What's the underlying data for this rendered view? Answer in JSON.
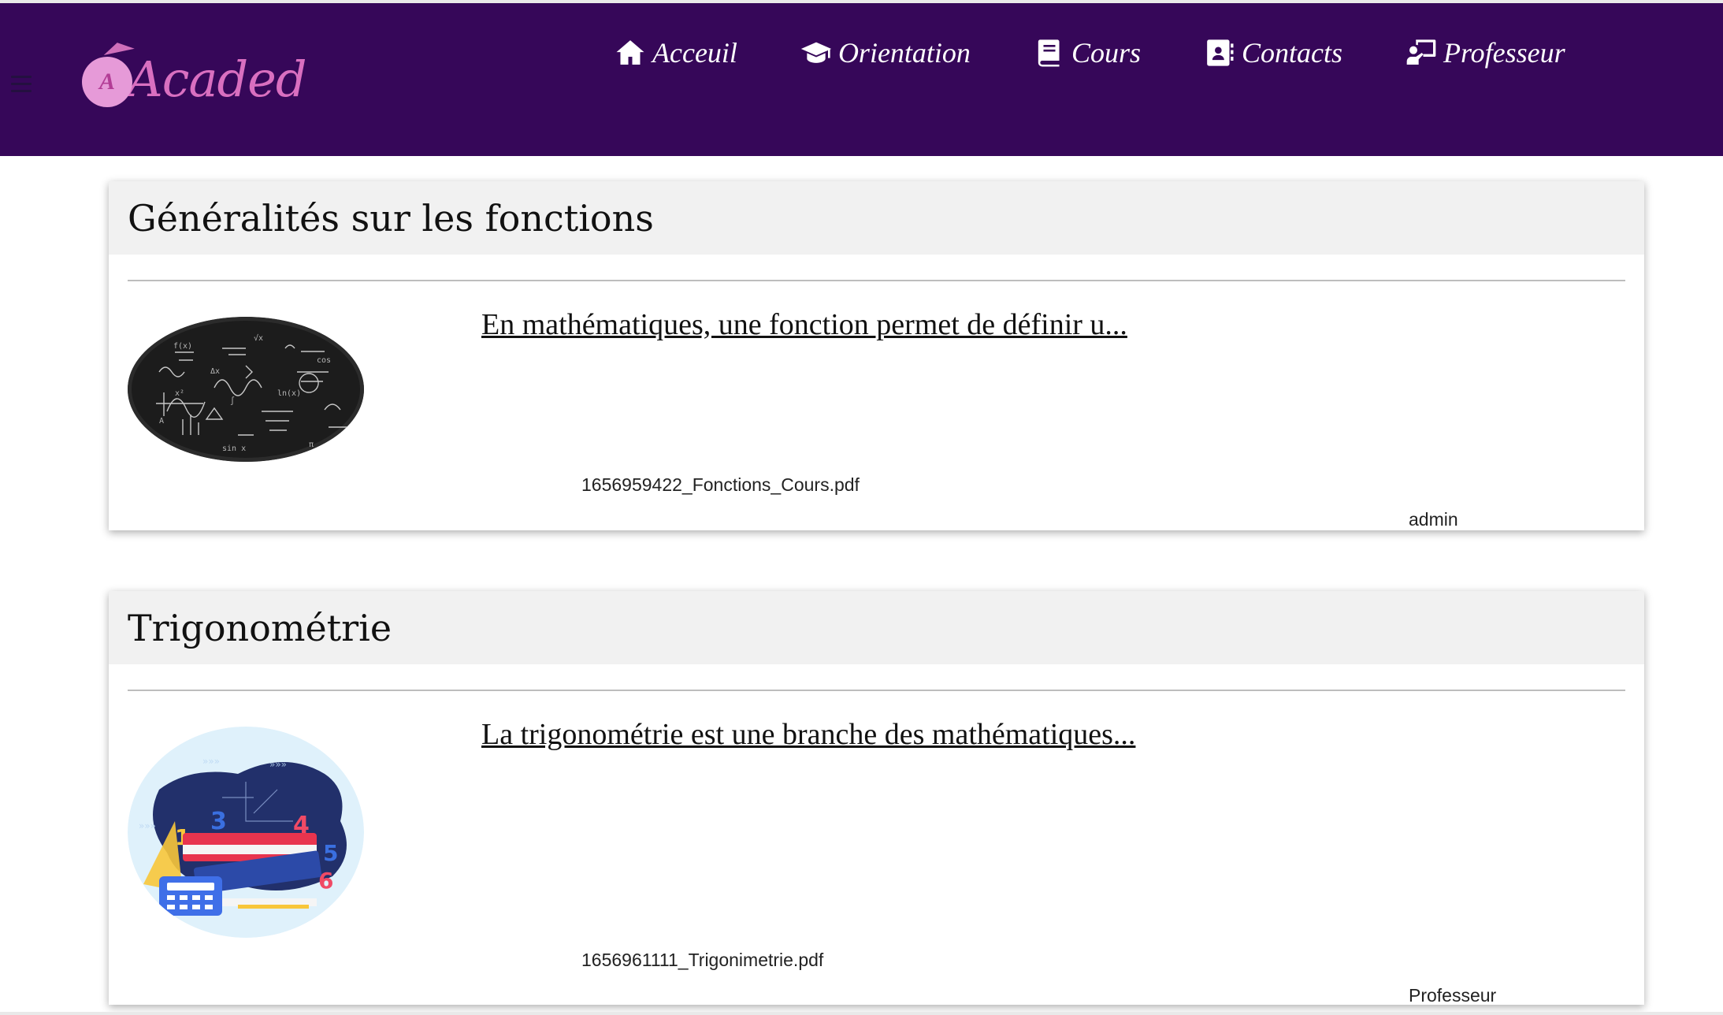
{
  "brand": {
    "name": "Acaded",
    "badge_letter": "A"
  },
  "nav": [
    {
      "label": "Acceuil",
      "icon": "home-icon"
    },
    {
      "label": "Orientation",
      "icon": "graduation-cap-icon"
    },
    {
      "label": "Cours",
      "icon": "book-icon"
    },
    {
      "label": "Contacts",
      "icon": "contact-book-icon"
    },
    {
      "label": "Professeur",
      "icon": "teacher-icon"
    }
  ],
  "courses": [
    {
      "title": "Généralités sur les fonctions",
      "excerpt": "En mathématiques, une fonction permet de définir u...",
      "file": "1656959422_Fonctions_Cours.pdf",
      "author": "admin",
      "image": "math-chalkboard-image"
    },
    {
      "title": "Trigonométrie",
      "excerpt": "La trigonométrie est une branche des mathématiques...",
      "file": "1656961111_Trigonimetrie.pdf",
      "author": "Professeur",
      "image": "trigonometry-books-image"
    }
  ],
  "colors": {
    "navbar": "#360759",
    "logo": "#d96fc0",
    "card_header": "#f1f1f1"
  }
}
